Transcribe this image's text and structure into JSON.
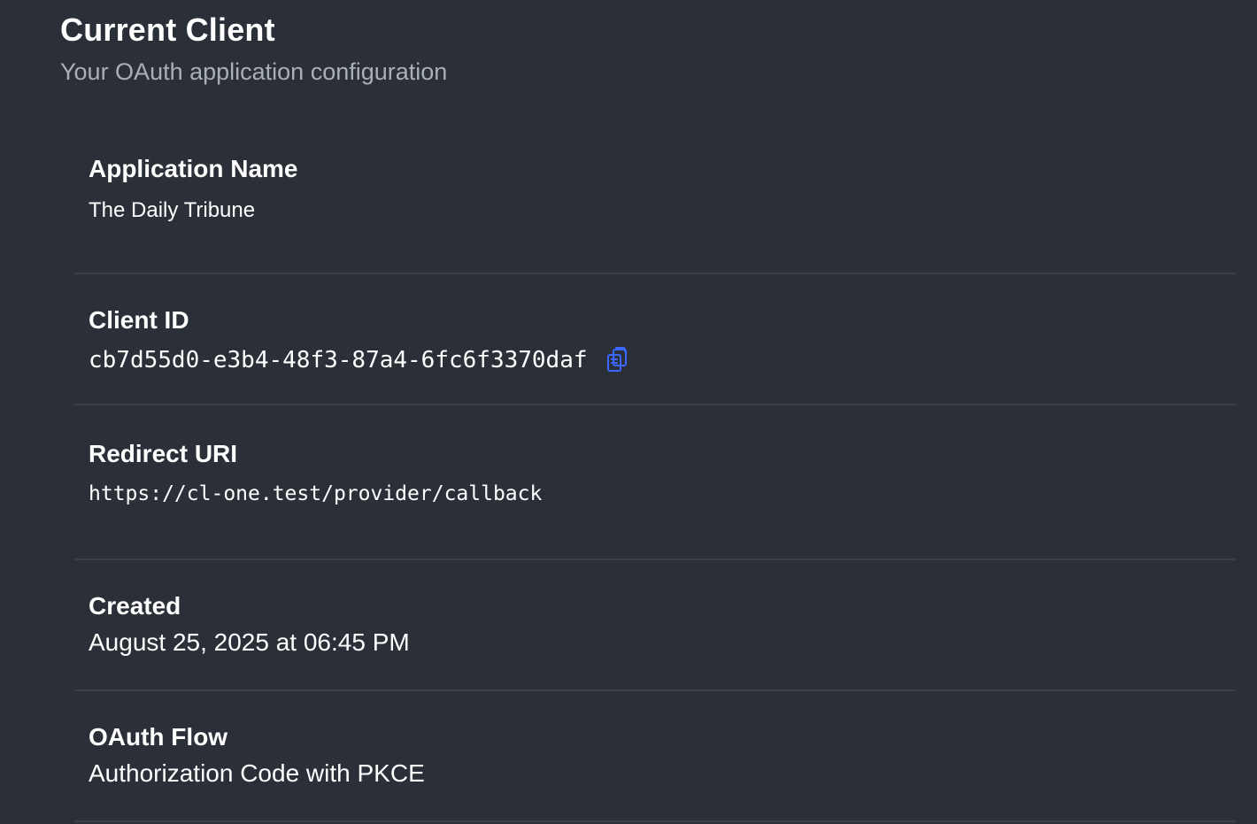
{
  "header": {
    "title": "Current Client",
    "subtitle": "Your OAuth application configuration"
  },
  "details": {
    "application_name": {
      "label": "Application Name",
      "value": "The Daily Tribune"
    },
    "client_id": {
      "label": "Client ID",
      "value": "cb7d55d0-e3b4-48f3-87a4-6fc6f3370daf",
      "copy_icon": "copy-icon"
    },
    "redirect_uri": {
      "label": "Redirect URI",
      "value": "https://cl-one.test/provider/callback"
    },
    "created": {
      "label": "Created",
      "value": "August 25, 2025 at 06:45 PM"
    },
    "oauth_flow": {
      "label": "OAuth Flow",
      "value": "Authorization Code with PKCE"
    }
  },
  "colors": {
    "background": "#2b2f38",
    "divider": "#3a3f4a",
    "subtitle": "#a9afb9",
    "accent": "#3b67ff"
  }
}
